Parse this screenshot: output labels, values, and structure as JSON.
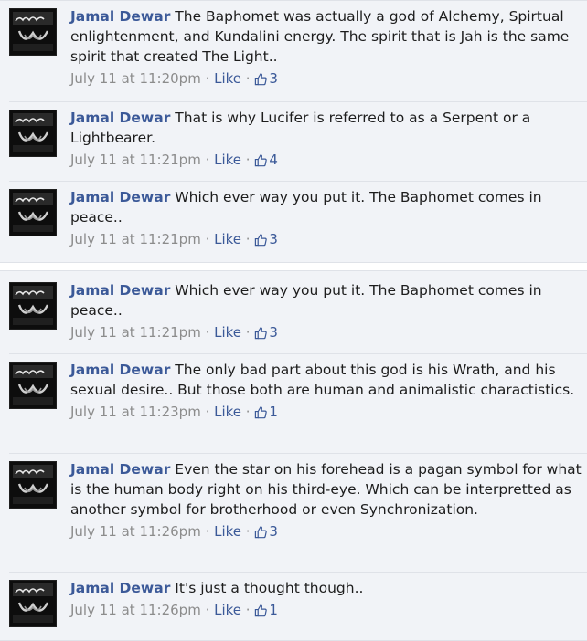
{
  "panels": [
    {
      "comments": [
        {
          "author": "Jamal Dewar",
          "text": "The Baphomet was actually a god of Alchemy, Spirtual enlightenment, and Kundalini energy. The spirit that is Jah is the same spirit that created The Light..",
          "timestamp": "July 11 at 11:20pm",
          "like_label": "Like",
          "likes": "3"
        },
        {
          "author": "Jamal Dewar",
          "text": "That is why Lucifer is referred to as a Serpent or a Lightbearer.",
          "timestamp": "July 11 at 11:21pm",
          "like_label": "Like",
          "likes": "4"
        },
        {
          "author": "Jamal Dewar",
          "text": "Which ever way you put it. The Baphomet comes in peace..",
          "timestamp": "July 11 at 11:21pm",
          "like_label": "Like",
          "likes": "3"
        }
      ]
    },
    {
      "comments": [
        {
          "author": "Jamal Dewar",
          "text": "Which ever way you put it. The Baphomet comes in peace..",
          "timestamp": "July 11 at 11:21pm",
          "like_label": "Like",
          "likes": "3"
        },
        {
          "author": "Jamal Dewar",
          "text": "The only bad part about this god is his Wrath, and his sexual desire.. But those both are human and animalistic charactistics.",
          "timestamp": "July 11 at 11:23pm",
          "like_label": "Like",
          "likes": "1"
        },
        {
          "author": "Jamal Dewar",
          "text": "Even the star on his forehead is a pagan symbol for what is the human body right on his third-eye. Which can be interpretted as another symbol for brotherhood or even Synchronization.",
          "timestamp": "July 11 at 11:26pm",
          "like_label": "Like",
          "likes": "3"
        },
        {
          "author": "Jamal Dewar",
          "text": "It's just a thought though..",
          "timestamp": "July 11 at 11:26pm",
          "like_label": "Like",
          "likes": "1"
        }
      ]
    }
  ],
  "separator": " · ",
  "icons": {
    "avatar": "profile-photo",
    "like": "thumbs-up-icon"
  },
  "colors": {
    "link": "#3b5998",
    "meta": "#8c8c8c",
    "panel_bg": "#f1f3f7"
  }
}
